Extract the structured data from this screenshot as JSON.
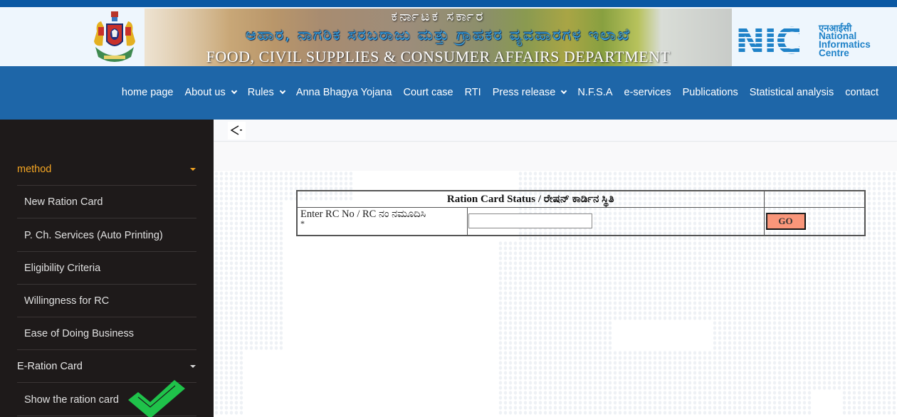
{
  "header": {
    "emblem": "karnataka-emblem",
    "banner": {
      "line1": "ಕರ್ನಾಟಕ ಸರ್ಕಾರ",
      "line2": "ಆಹಾರ, ನಾಗರಿಕ ಸರಬರಾಜು ಮತ್ತು ಗ್ರಾಹಕರ ವ್ಯವಹಾರಗಳ ಇಲಾಖೆ",
      "line3": "FOOD, CIVIL SUPPLIES & CONSUMER AFFAIRS DEPARTMENT"
    },
    "nic": {
      "letters": "NIC",
      "hindi": "एनआईसी",
      "line1": "National",
      "line2": "Informatics",
      "line3": "Centre"
    }
  },
  "nav": {
    "items": [
      {
        "label": "home page",
        "dropdown": false
      },
      {
        "label": "About us",
        "dropdown": true
      },
      {
        "label": "Rules",
        "dropdown": true
      },
      {
        "label": "Anna Bhagya Yojana",
        "dropdown": false
      },
      {
        "label": "Court case",
        "dropdown": false
      },
      {
        "label": "RTI",
        "dropdown": false
      },
      {
        "label": "Press release",
        "dropdown": true
      },
      {
        "label": "N.F.S.A",
        "dropdown": false
      },
      {
        "label": "e-services",
        "dropdown": false
      },
      {
        "label": "Publications",
        "dropdown": false
      },
      {
        "label": "Statistical analysis",
        "dropdown": false
      },
      {
        "label": "contact",
        "dropdown": false
      }
    ]
  },
  "sidebar": {
    "groups": [
      {
        "label": "method",
        "active": true
      },
      {
        "label": "E-Ration Card",
        "active": false
      }
    ],
    "method_items": [
      "New Ration Card",
      "P. Ch. Services (Auto Printing)",
      "Eligibility Criteria",
      "Willingness for RC",
      "Ease of Doing Business"
    ],
    "eration_items": [
      "Show the ration card"
    ],
    "active_color": "#f5a623",
    "check_color": "#1fc24a"
  },
  "content": {
    "back_label": "<·",
    "form": {
      "title": "Ration Card Status / ರೇಷನ್ ಕಾರ್ಡಿನ ಸ್ಥಿತಿ",
      "rc_label": "Enter RC No / RC ನಂ ನಮೂದಿಸಿ",
      "required_mark": "*",
      "rc_value": "",
      "go_label": "GO",
      "go_color": "#f9967a"
    }
  }
}
